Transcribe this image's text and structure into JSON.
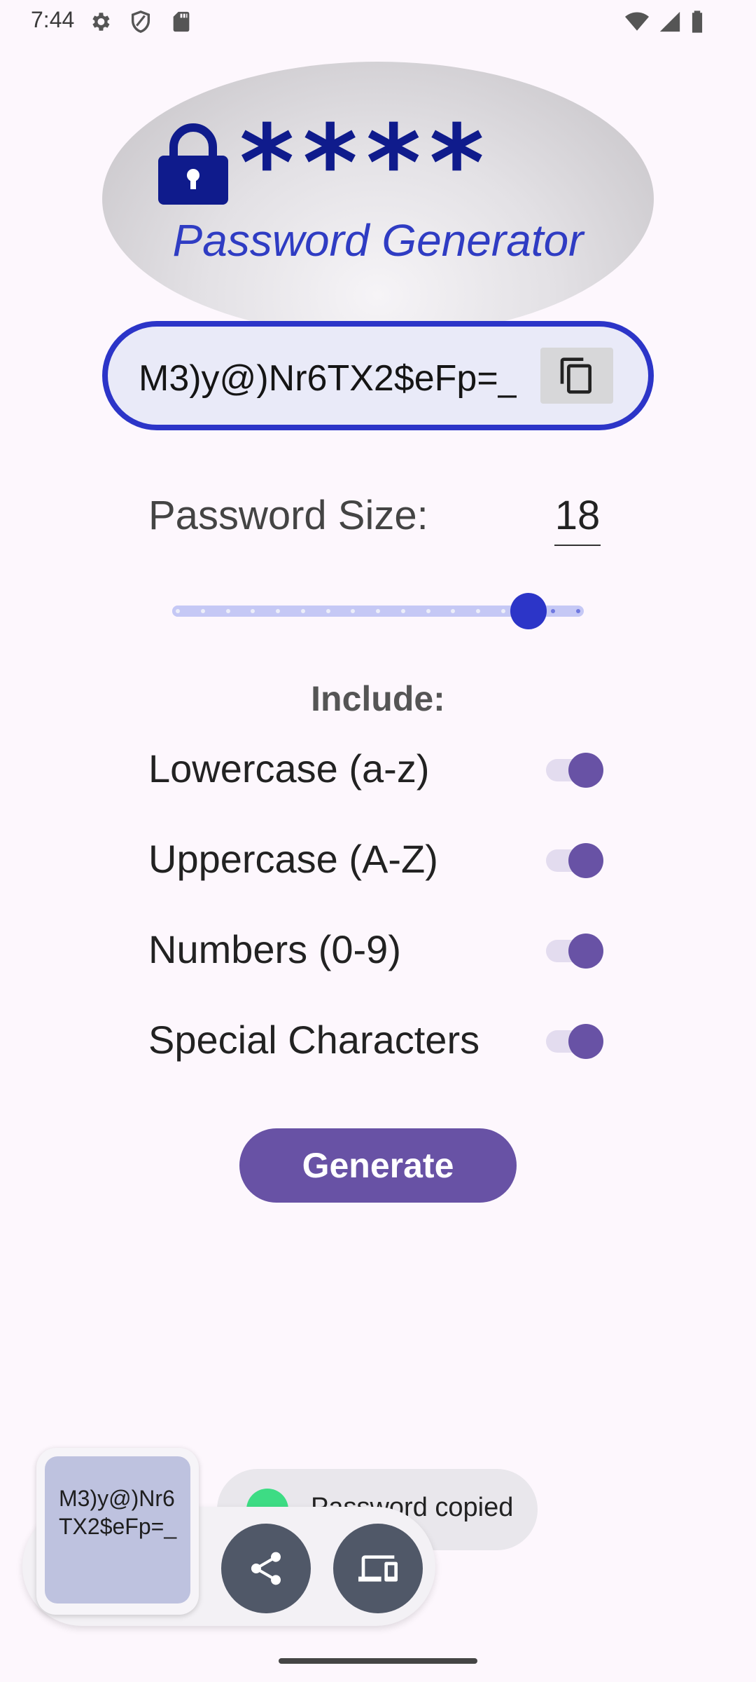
{
  "status_bar": {
    "time": "7:44"
  },
  "logo": {
    "stars": "****",
    "title": "Password Generator"
  },
  "password": {
    "value": "M3)y@)Nr6TX2$eFp=_"
  },
  "size": {
    "label": "Password Size:",
    "value": "18",
    "slider_min": 4,
    "slider_max": 20,
    "slider_value": 18
  },
  "include": {
    "label": "Include:",
    "options": [
      {
        "label": "Lowercase (a-z)",
        "checked": true
      },
      {
        "label": "Uppercase (A-Z)",
        "checked": true
      },
      {
        "label": "Numbers (0-9)",
        "checked": true
      },
      {
        "label": "Special Characters",
        "checked": true
      }
    ]
  },
  "generate_label": "Generate",
  "toast": {
    "text": "Password copied"
  },
  "clipboard": {
    "preview_text": "M3)y@)Nr6TX2$eFp=_"
  },
  "colors": {
    "accent_blue": "#2c35c8",
    "accent_purple": "#6852a5",
    "logo_navy": "#0f1b8c"
  },
  "icons": [
    "settings-icon",
    "shield-icon",
    "sd-card-icon",
    "wifi-icon",
    "signal-icon",
    "battery-icon",
    "lock-icon",
    "copy-icon",
    "share-icon",
    "nearby-devices-icon"
  ]
}
